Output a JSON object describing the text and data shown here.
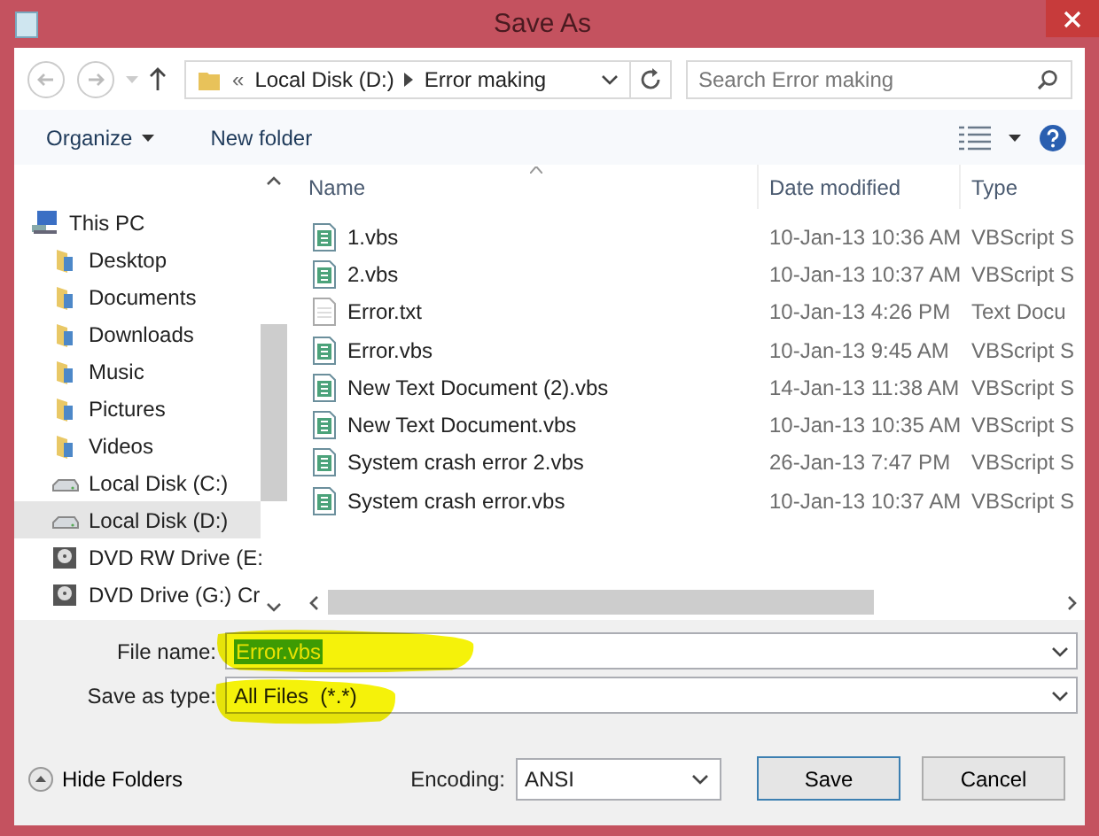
{
  "window": {
    "title": "Save As"
  },
  "navigation": {
    "overflow": "«",
    "path": [
      "Local Disk (D:)",
      "Error making"
    ],
    "search_placeholder": "Search Error making"
  },
  "toolbar": {
    "buttons": [
      {
        "label": "Organize",
        "has_menu": true
      },
      {
        "label": "New folder",
        "has_menu": false
      }
    ]
  },
  "sidebar": {
    "items": [
      {
        "label": "This PC",
        "kind": "computer",
        "selected": false,
        "children": [
          {
            "label": "Desktop",
            "kind": "folder",
            "selected": false
          },
          {
            "label": "Documents",
            "kind": "folder",
            "selected": false
          },
          {
            "label": "Downloads",
            "kind": "folder",
            "selected": false
          },
          {
            "label": "Music",
            "kind": "folder",
            "selected": false
          },
          {
            "label": "Pictures",
            "kind": "folder",
            "selected": false
          },
          {
            "label": "Videos",
            "kind": "folder",
            "selected": false
          },
          {
            "label": "Local Disk (C:)",
            "kind": "disk",
            "selected": false
          },
          {
            "label": "Local Disk (D:)",
            "kind": "disk",
            "selected": true
          },
          {
            "label": "DVD RW Drive (E:",
            "kind": "optical",
            "selected": false
          },
          {
            "label": "DVD Drive (G:) Cr",
            "kind": "optical",
            "selected": false
          }
        ]
      }
    ]
  },
  "file_list": {
    "columns": [
      {
        "label": "Name",
        "sorted": true
      },
      {
        "label": "Date modified",
        "sorted": false
      },
      {
        "label": "Type",
        "sorted": false
      }
    ],
    "rows": [
      {
        "kind": "script",
        "name": "1.vbs",
        "date": "10-Jan-13 10:36 AM",
        "type": "VBScript S"
      },
      {
        "kind": "script",
        "name": "2.vbs",
        "date": "10-Jan-13 10:37 AM",
        "type": "VBScript S"
      },
      {
        "kind": "text",
        "name": "Error.txt",
        "date": "10-Jan-13 4:26 PM",
        "type": "Text Docu"
      },
      {
        "kind": "script",
        "name": "Error.vbs",
        "date": "10-Jan-13 9:45 AM",
        "type": "VBScript S"
      },
      {
        "kind": "script",
        "name": "New Text Document (2).vbs",
        "date": "14-Jan-13 11:38 AM",
        "type": "VBScript S"
      },
      {
        "kind": "script",
        "name": "New Text Document.vbs",
        "date": "10-Jan-13 10:35 AM",
        "type": "VBScript S"
      },
      {
        "kind": "script",
        "name": "System crash error 2.vbs",
        "date": "26-Jan-13 7:47 PM",
        "type": "VBScript S"
      },
      {
        "kind": "script",
        "name": "System crash error.vbs",
        "date": "10-Jan-13 10:37 AM",
        "type": "VBScript S"
      }
    ]
  },
  "save_form": {
    "file_name": {
      "label": "File name:",
      "value": "Error.vbs",
      "text_selected": true,
      "highlighted": true
    },
    "save_type": {
      "label": "Save as type:",
      "value": "All Files  (*.*)",
      "highlighted": true
    }
  },
  "footer": {
    "hide_folders": "Hide Folders",
    "encoding_label": "Encoding:",
    "encoding": "ANSI",
    "buttons": [
      {
        "label": "Save",
        "default": true
      },
      {
        "label": "Cancel",
        "default": false
      }
    ]
  }
}
